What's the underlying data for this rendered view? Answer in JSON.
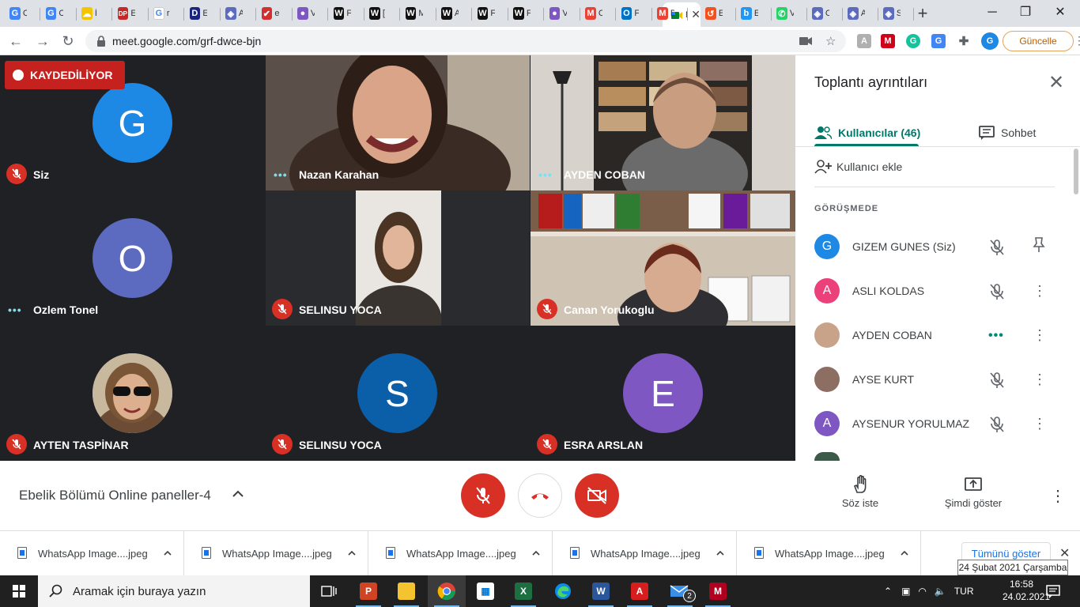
{
  "browser": {
    "tabs": [
      {
        "label": "C",
        "icon": "google-search-favicon",
        "color": "#4285f4"
      },
      {
        "label": "C",
        "icon": "google-search-favicon",
        "color": "#4285f4"
      },
      {
        "label": "İ",
        "icon": "cloud-favicon",
        "color": "#f5c400"
      },
      {
        "label": "E",
        "icon": "dp-favicon",
        "color": "#c62828"
      },
      {
        "label": "r",
        "icon": "google-favicon",
        "color": "#ffffff"
      },
      {
        "label": "E",
        "icon": "d-favicon",
        "color": "#1a237e"
      },
      {
        "label": "A",
        "icon": "shield-favicon",
        "color": "#5c6bc0"
      },
      {
        "label": "e",
        "icon": "checkmark-favicon",
        "color": "#d32f2f"
      },
      {
        "label": "V",
        "icon": "orb-favicon",
        "color": "#7e57c2"
      },
      {
        "label": "F",
        "icon": "wikipedia-favicon",
        "color": "#111111"
      },
      {
        "label": "[",
        "icon": "wikipedia-favicon",
        "color": "#111111"
      },
      {
        "label": "M",
        "icon": "wikipedia-favicon",
        "color": "#111111"
      },
      {
        "label": "A",
        "icon": "wikipedia-favicon",
        "color": "#111111"
      },
      {
        "label": "F",
        "icon": "wikipedia-favicon",
        "color": "#111111"
      },
      {
        "label": "F",
        "icon": "wikipedia-favicon",
        "color": "#111111"
      },
      {
        "label": "V",
        "icon": "orb-favicon",
        "color": "#7e57c2"
      },
      {
        "label": "C",
        "icon": "gmail-favicon",
        "color": "#ea4335"
      },
      {
        "label": "F",
        "icon": "outlook-favicon",
        "color": "#0072c6"
      },
      {
        "label": "D",
        "icon": "gmail-favicon",
        "color": "#ea4335"
      }
    ],
    "active_tab": {
      "label": "M",
      "close": "✕"
    },
    "tabs_right": [
      {
        "label": "E",
        "icon": "history-favicon",
        "color": "#f4511e"
      },
      {
        "label": "E",
        "icon": "bip-favicon",
        "color": "#2196f3"
      },
      {
        "label": "V",
        "icon": "whatsapp-favicon",
        "color": "#25d366"
      },
      {
        "label": "C",
        "icon": "shield-favicon",
        "color": "#5c6bc0"
      },
      {
        "label": "A",
        "icon": "shield-favicon",
        "color": "#5c6bc0"
      },
      {
        "label": "S",
        "icon": "shield-favicon",
        "color": "#5c6bc0"
      }
    ],
    "url": "meet.google.com/grf-dwce-bjn",
    "update_label": "Güncelle",
    "profile_initial": "G"
  },
  "meet": {
    "recording_label": "KAYDEDİLİYOR",
    "tiles": [
      {
        "name": "Siz",
        "initial": "G",
        "color": "#1e88e5",
        "status": "muted",
        "type": "avatar"
      },
      {
        "name": "Nazan Karahan",
        "status": "speaking",
        "type": "video"
      },
      {
        "name": "AYDEN COBAN",
        "status": "speaking",
        "type": "video"
      },
      {
        "name": "Ozlem Tonel",
        "initial": "O",
        "color": "#5c6bc0",
        "status": "speaking",
        "type": "avatar"
      },
      {
        "name": "SELINSU YOCA",
        "status": "muted",
        "type": "video"
      },
      {
        "name": "Canan Yorukoglu",
        "status": "muted",
        "type": "video"
      },
      {
        "name": "AYTEN TASPİNAR",
        "status": "muted",
        "type": "photo"
      },
      {
        "name": "SELINSU YOCA",
        "initial": "S",
        "color": "#0b5ea8",
        "status": "muted",
        "type": "avatar"
      },
      {
        "name": "ESRA ARSLAN",
        "initial": "E",
        "color": "#7e57c2",
        "status": "muted",
        "type": "avatar"
      }
    ]
  },
  "panel": {
    "title": "Toplantı ayrıntıları",
    "tab_people": "Kullanıcılar (46)",
    "tab_chat": "Sohbet",
    "add_user": "Kullanıcı ekle",
    "section": "GÖRÜŞMEDE",
    "accent": "#00796b",
    "participants": [
      {
        "name": "GIZEM GUNES (Siz)",
        "initial": "G",
        "color": "#1e88e5",
        "action1": "mic-off-icon",
        "action2": "pin-icon"
      },
      {
        "name": "ASLI KOLDAS",
        "initial": "A",
        "color": "#ec407a",
        "action1": "mic-off-icon",
        "action2": "more-vert-icon"
      },
      {
        "name": "AYDEN COBAN",
        "initial": "",
        "color": "#c8a38a",
        "action1": "speaking-icon",
        "action2": "more-vert-icon"
      },
      {
        "name": "AYSE KURT",
        "initial": "",
        "color": "#8d6e63",
        "action1": "mic-off-icon",
        "action2": "more-vert-icon"
      },
      {
        "name": "AYSENUR YORULMAZ",
        "initial": "A",
        "color": "#7e57c2",
        "action1": "mic-off-icon",
        "action2": "more-vert-icon"
      }
    ]
  },
  "controls": {
    "meeting_title": "Ebelik Bölümü Online paneller-4",
    "raise_hand": "Söz iste",
    "present_now": "Şimdi göster"
  },
  "downloads": {
    "items": [
      "WhatsApp Image....jpeg",
      "WhatsApp Image....jpeg",
      "WhatsApp Image....jpeg",
      "WhatsApp Image....jpeg",
      "WhatsApp Image....jpeg"
    ],
    "show_all": "Tümünü göster",
    "tooltip": "24 Şubat 2021 Çarşamba"
  },
  "taskbar": {
    "search_placeholder": "Aramak için buraya yazın",
    "apps": [
      "task-view",
      "powerpoint",
      "file-explorer",
      "chrome",
      "store",
      "excel",
      "edge",
      "word",
      "acrobat",
      "mail",
      "mendeley"
    ],
    "mail_badge": "2",
    "language": "TUR",
    "time": "16:58",
    "date": "24.02.2021"
  }
}
